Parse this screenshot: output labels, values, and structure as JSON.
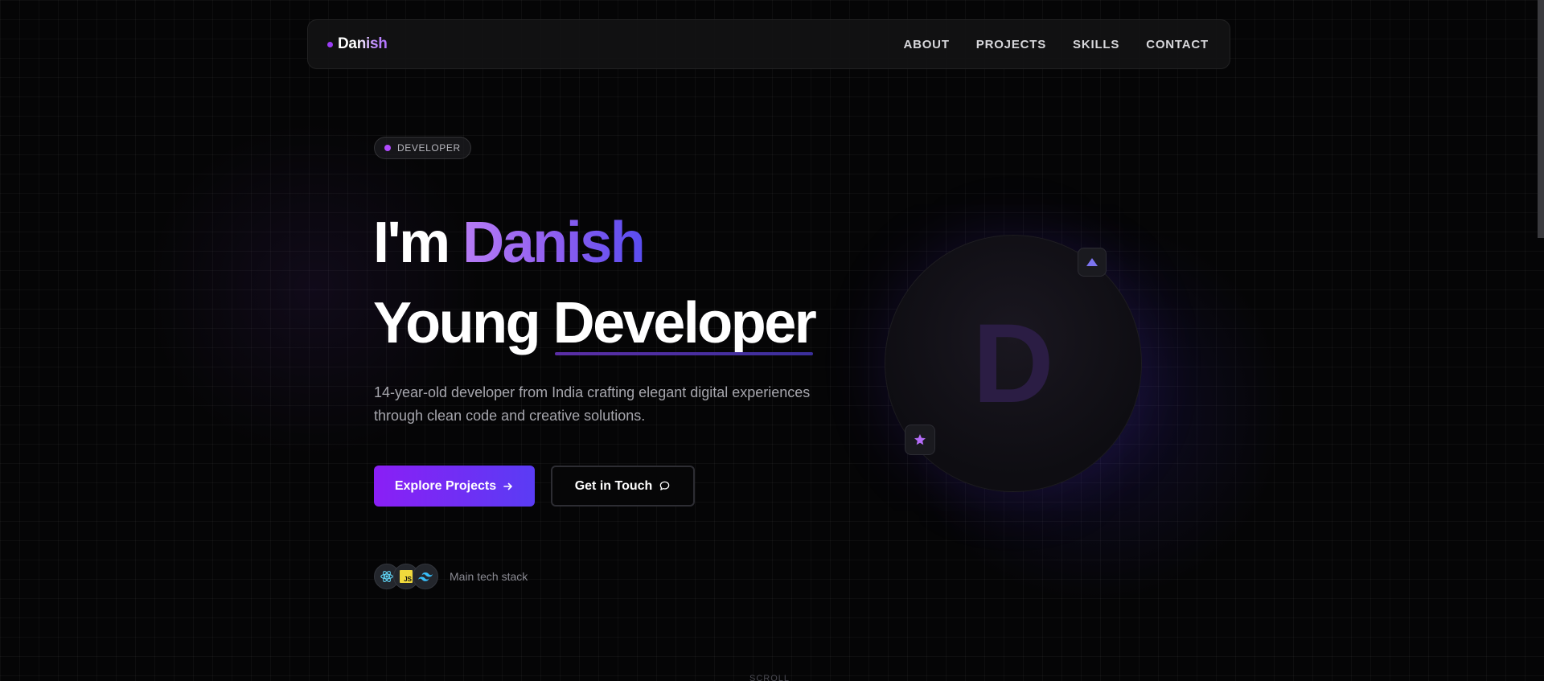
{
  "nav": {
    "logo": "Danish",
    "links": [
      "ABOUT",
      "PROJECTS",
      "SKILLS",
      "CONTACT"
    ]
  },
  "hero": {
    "badge": "DEVELOPER",
    "greeting": "I'm",
    "name": "Danish",
    "title_prefix": "Young",
    "title_highlight": "Developer",
    "subtitle_line1": "14-year-old developer from India crafting elegant digital experiences",
    "subtitle_line2": "through clean code and creative solutions.",
    "primary_cta": "Explore Projects",
    "secondary_cta": "Get in Touch",
    "tech_stack_label": "Main tech stack",
    "tech_stack_icons": [
      "react-icon",
      "javascript-icon",
      "tailwind-icon"
    ],
    "js_badge": "JS"
  },
  "avatar": {
    "initial": "D",
    "chips": [
      "triangle-icon",
      "star-icon"
    ]
  },
  "scroll_hint": "SCROLL",
  "colors": {
    "background": "#050506",
    "accent_purple": "#9b3df5",
    "accent_indigo": "#5a3cf4",
    "text_muted": "#a6a6ad"
  }
}
